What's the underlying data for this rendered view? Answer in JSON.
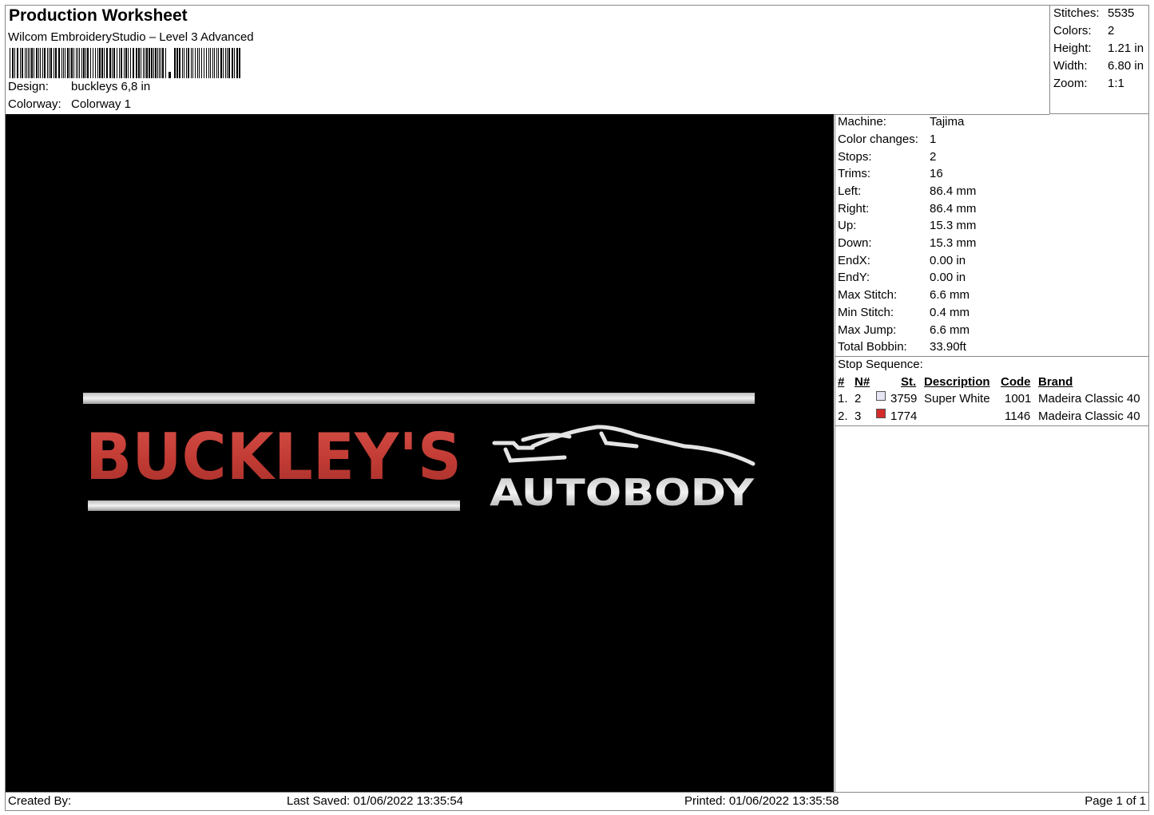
{
  "header": {
    "title": "Production Worksheet",
    "subtitle": "Wilcom EmbroideryStudio – Level 3 Advanced",
    "design_label": "Design:",
    "design_value": "buckleys 6,8 in",
    "colorway_label": "Colorway:",
    "colorway_value": "Colorway 1"
  },
  "summary": [
    {
      "label": "Stitches:",
      "value": "5535"
    },
    {
      "label": "Colors:",
      "value": "2"
    },
    {
      "label": "Height:",
      "value": "1.21 in"
    },
    {
      "label": "Width:",
      "value": "6.80 in"
    },
    {
      "label": "Zoom:",
      "value": "1:1"
    }
  ],
  "design_preview": {
    "background": "#000000",
    "main_text": "BUCKLEY'S",
    "sub_text": "AUTOBODY",
    "red": "#c8403a",
    "white": "#e8e8e8"
  },
  "machine": [
    {
      "label": "Machine:",
      "value": "Tajima"
    },
    {
      "label": "Color changes:",
      "value": "1"
    },
    {
      "label": "Stops:",
      "value": "2"
    },
    {
      "label": "Trims:",
      "value": "16"
    },
    {
      "label": "Left:",
      "value": "86.4 mm"
    },
    {
      "label": "Right:",
      "value": "86.4 mm"
    },
    {
      "label": "Up:",
      "value": "15.3 mm"
    },
    {
      "label": "Down:",
      "value": "15.3 mm"
    },
    {
      "label": "EndX:",
      "value": "0.00 in"
    },
    {
      "label": "EndY:",
      "value": "0.00 in"
    },
    {
      "label": "Max Stitch:",
      "value": "6.6 mm"
    },
    {
      "label": "Min Stitch:",
      "value": "0.4 mm"
    },
    {
      "label": "Max Jump:",
      "value": "6.6 mm"
    },
    {
      "label": "Total Bobbin:",
      "value": "33.90ft"
    }
  ],
  "stop_sequence": {
    "title": "Stop Sequence:",
    "headers": {
      "num": "#",
      "n": "N#",
      "st": "St.",
      "desc": "Description",
      "code": "Code",
      "brand": "Brand"
    },
    "rows": [
      {
        "num": "1.",
        "n": "2",
        "color": "#e6e6f5",
        "st": "3759",
        "desc": "Super White",
        "code": "1001",
        "brand": "Madeira Classic 40"
      },
      {
        "num": "2.",
        "n": "3",
        "color": "#d42a2a",
        "st": "1774",
        "desc": "",
        "code": "1146",
        "brand": "Madeira Classic 40"
      }
    ]
  },
  "footer": {
    "created_by": "Created By:",
    "last_saved": "Last Saved: 01/06/2022 13:35:54",
    "printed": "Printed: 01/06/2022 13:35:58",
    "page": "Page 1 of 1"
  }
}
